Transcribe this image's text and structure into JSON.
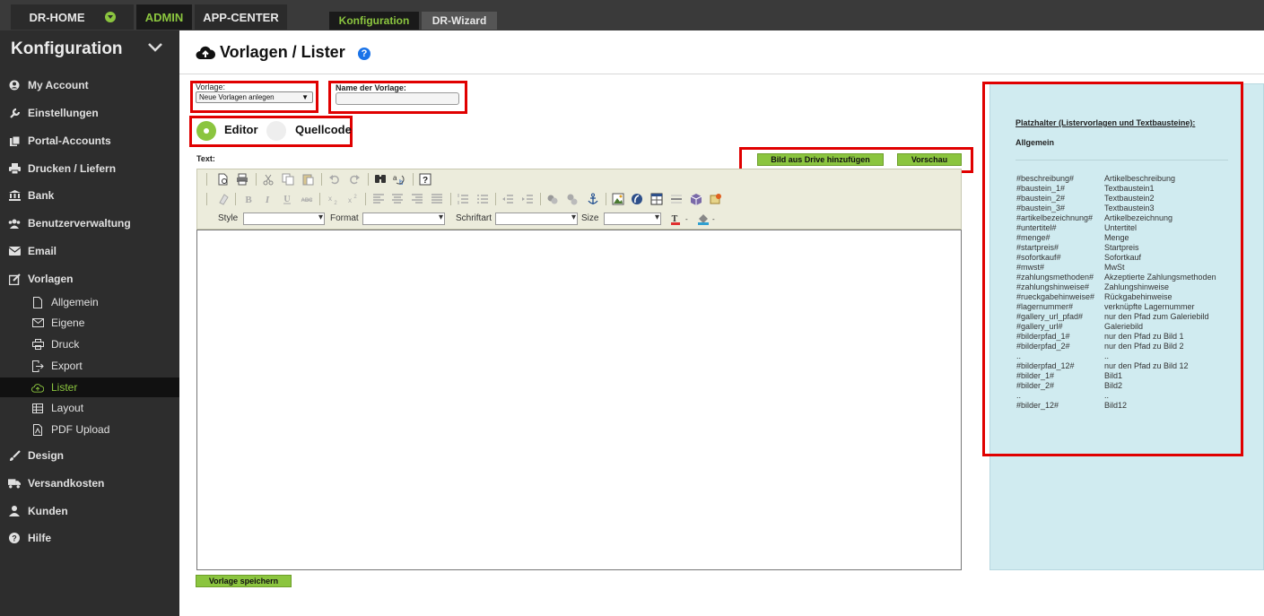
{
  "topbar": {
    "tabs": [
      {
        "label": "DR-HOME"
      },
      {
        "label": "ADMIN"
      },
      {
        "label": "APP-CENTER"
      }
    ],
    "subtabs": [
      {
        "label": "Konfiguration"
      },
      {
        "label": "DR-Wizard"
      }
    ]
  },
  "sidebar": {
    "title": "Konfiguration",
    "items": [
      {
        "label": "My Account",
        "icon": "user-circle-icon"
      },
      {
        "label": "Einstellungen",
        "icon": "wrench-icon"
      },
      {
        "label": "Portal-Accounts",
        "icon": "copy-icon"
      },
      {
        "label": "Drucken / Liefern",
        "icon": "printer-icon"
      },
      {
        "label": "Bank",
        "icon": "bank-icon"
      },
      {
        "label": "Benutzerverwaltung",
        "icon": "users-icon"
      },
      {
        "label": "Email",
        "icon": "envelope-icon"
      },
      {
        "label": "Vorlagen",
        "icon": "edit-icon"
      }
    ],
    "subitems": [
      {
        "label": "Allgemein",
        "icon": "file-icon"
      },
      {
        "label": "Eigene",
        "icon": "mail-icon"
      },
      {
        "label": "Druck",
        "icon": "print-icon"
      },
      {
        "label": "Export",
        "icon": "export-icon"
      },
      {
        "label": "Lister",
        "icon": "cloud-upload-icon"
      },
      {
        "label": "Layout",
        "icon": "table-icon"
      },
      {
        "label": "PDF Upload",
        "icon": "pdf-icon"
      }
    ],
    "items_after": [
      {
        "label": "Design",
        "icon": "brush-icon"
      },
      {
        "label": "Versandkosten",
        "icon": "truck-icon"
      },
      {
        "label": "Kunden",
        "icon": "user-icon"
      },
      {
        "label": "Hilfe",
        "icon": "question-icon"
      }
    ]
  },
  "header": {
    "title": "Vorlagen / Lister",
    "help_symbol": "?"
  },
  "form": {
    "vorlage_label": "Vorlage:",
    "vorlage_selected": "Neue Vorlagen anlegen",
    "name_label": "Name der Vorlage:",
    "name_value": "",
    "mode_editor": "Editor",
    "mode_source": "Quellcode",
    "text_label": "Text:",
    "btn_drive": "Bild aus Drive hinzufügen",
    "btn_preview": "Vorschau",
    "btn_save": "Vorlage speichern"
  },
  "toolbar": {
    "combos": [
      {
        "label": "Style"
      },
      {
        "label": "Format"
      },
      {
        "label": "Schriftart"
      },
      {
        "label": "Size"
      }
    ]
  },
  "placeholders": {
    "title": "Platzhalter (Listervorlagen und Textbausteine):",
    "section": "Allgemein",
    "rows": [
      {
        "key": "#beschreibung#",
        "desc": "Artikelbeschreibung"
      },
      {
        "key": "#baustein_1#",
        "desc": "Textbaustein1"
      },
      {
        "key": "#baustein_2#",
        "desc": "Textbaustein2"
      },
      {
        "key": "#baustein_3#",
        "desc": "Textbaustein3"
      },
      {
        "key": "#artikelbezeichnung#",
        "desc": "Artikelbezeichnung"
      },
      {
        "key": "#untertitel#",
        "desc": "Untertitel"
      },
      {
        "key": "#menge#",
        "desc": "Menge"
      },
      {
        "key": "#startpreis#",
        "desc": "Startpreis"
      },
      {
        "key": "#sofortkauf#",
        "desc": "Sofortkauf"
      },
      {
        "key": "#mwst#",
        "desc": "MwSt"
      },
      {
        "key": "#zahlungsmethoden#",
        "desc": "Akzeptierte Zahlungsmethoden"
      },
      {
        "key": "#zahlungshinweise#",
        "desc": "Zahlungshinweise"
      },
      {
        "key": "#rueckgabehinweise#",
        "desc": "Rückgabehinweise"
      },
      {
        "key": "#lagernummer#",
        "desc": "verknüpfte Lagernummer"
      },
      {
        "key": "#gallery_url_pfad#",
        "desc": "nur den Pfad zum Galeriebild"
      },
      {
        "key": "#gallery_url#",
        "desc": "Galeriebild"
      },
      {
        "key": "#bilderpfad_1#",
        "desc": "nur den Pfad zu Bild 1"
      },
      {
        "key": "#bilderpfad_2#",
        "desc": "nur den Pfad zu Bild 2"
      },
      {
        "key": "..",
        "desc": ".."
      },
      {
        "key": "#bilderpfad_12#",
        "desc": "nur den Pfad zu Bild 12"
      },
      {
        "key": "#bilder_1#",
        "desc": "Bild1"
      },
      {
        "key": "#bilder_2#",
        "desc": "Bild2"
      },
      {
        "key": "..",
        "desc": ".."
      },
      {
        "key": "#bilder_12#",
        "desc": "Bild12"
      }
    ]
  },
  "colors": {
    "accent_green": "#8bc53f",
    "highlight_red": "#e00000",
    "sidebar_bg": "#2d2d2d",
    "panel_bg": "#d0ebf0"
  }
}
